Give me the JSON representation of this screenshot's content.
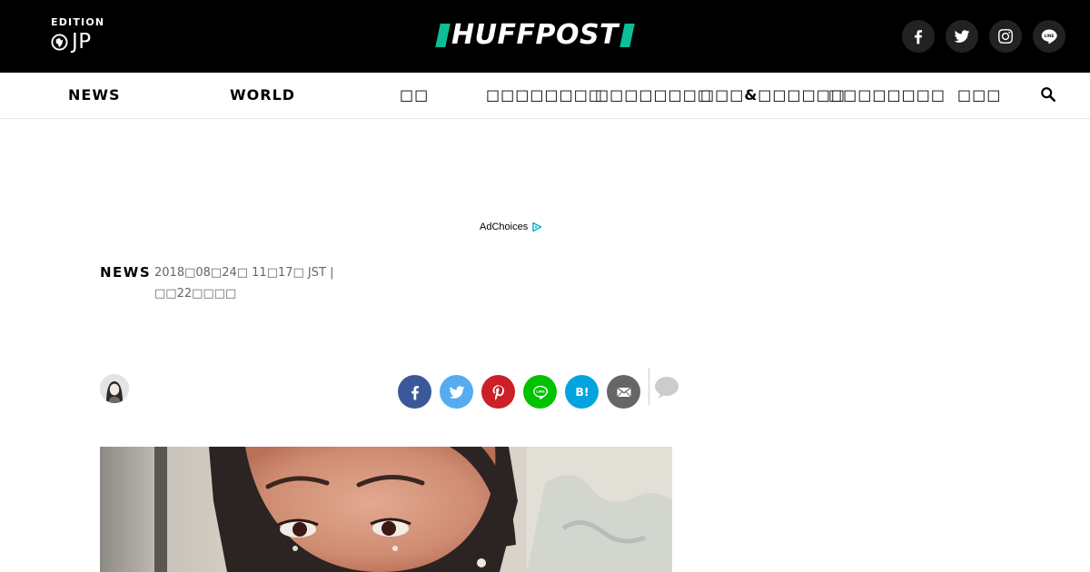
{
  "header": {
    "edition_label": "EDITION",
    "edition_code": "JP",
    "logo_text": "HUFFPOST",
    "social": [
      "facebook-icon",
      "twitter-icon",
      "instagram-icon",
      "line-icon"
    ]
  },
  "nav": {
    "items": [
      {
        "label": "NEWS"
      },
      {
        "label": "WORLD"
      },
      {
        "label": "□□"
      },
      {
        "label": "□□□□□□□□"
      },
      {
        "label": "□□□□□□□□"
      },
      {
        "label": "□□□&□□□□□□"
      },
      {
        "label": "□□□□□□□□"
      },
      {
        "label": "□□□"
      }
    ]
  },
  "ad": {
    "adchoices_label": "AdChoices"
  },
  "article": {
    "section": "NEWS",
    "timestamp": "2018□08□24□ 11□17□ JST |",
    "updated": "□□22□□□□"
  },
  "colors": {
    "topbar": "#000000",
    "logo_accent": "#0dbe98",
    "facebook": "#3b5998",
    "twitter": "#55acee",
    "pinterest": "#cb2027",
    "line": "#00c300",
    "hatena": "#00a4de",
    "email": "#666666"
  }
}
